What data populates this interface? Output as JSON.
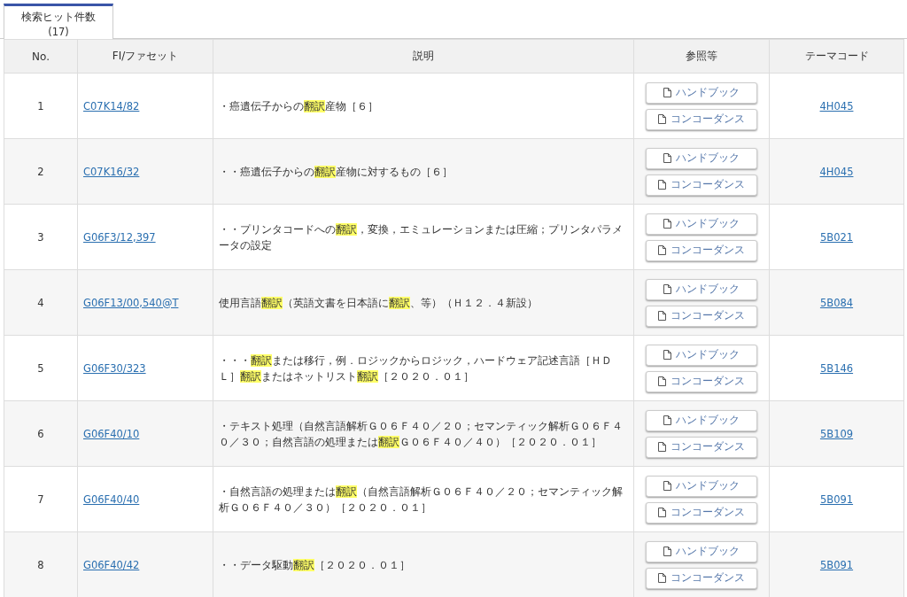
{
  "tab": {
    "label": "検索ヒット件数",
    "count": "(17)",
    "selected": true
  },
  "table": {
    "columns": [
      "No.",
      "FI/ファセット",
      "説明",
      "参照等",
      "テーマコード"
    ],
    "rows": [
      {
        "no": "1",
        "fi": "C07K14/82",
        "description": [
          {
            "text": "・癌遺伝子からの",
            "highlighted": false
          },
          {
            "text": "翻訳",
            "highlighted": true
          },
          {
            "text": "産物［６］",
            "highlighted": false
          }
        ],
        "buttons": [
          "ハンドブック",
          "コンコーダンス"
        ],
        "theme": "4H045"
      },
      {
        "no": "2",
        "fi": "C07K16/32",
        "description": [
          {
            "text": "・・癌遺伝子からの",
            "highlighted": false
          },
          {
            "text": "翻訳",
            "highlighted": true
          },
          {
            "text": "産物に対するもの［６］",
            "highlighted": false
          }
        ],
        "buttons": [
          "ハンドブック",
          "コンコーダンス"
        ],
        "theme": "4H045"
      },
      {
        "no": "3",
        "fi": "G06F3/12,397",
        "description": [
          {
            "text": "・・プリンタコードへの",
            "highlighted": false
          },
          {
            "text": "翻訳",
            "highlighted": true
          },
          {
            "text": "，変換，エミュレーションまたは圧縮；プリンタパラメータの設定",
            "highlighted": false
          }
        ],
        "buttons": [
          "ハンドブック",
          "コンコーダンス"
        ],
        "theme": "5B021"
      },
      {
        "no": "4",
        "fi": "G06F13/00,540@T",
        "description": [
          {
            "text": "使用言語",
            "highlighted": false
          },
          {
            "text": "翻訳",
            "highlighted": true
          },
          {
            "text": "（英語文書を日本語に",
            "highlighted": false
          },
          {
            "text": "翻訳",
            "highlighted": true
          },
          {
            "text": "、等）（Ｈ１２．４新設）",
            "highlighted": false
          }
        ],
        "buttons": [
          "ハンドブック",
          "コンコーダンス"
        ],
        "theme": "5B084"
      },
      {
        "no": "5",
        "fi": "G06F30/323",
        "description": [
          {
            "text": "・・・",
            "highlighted": false
          },
          {
            "text": "翻訳",
            "highlighted": true
          },
          {
            "text": "または移行，例．ロジックからロジック，ハードウェア記述言語［ＨＤＬ］",
            "highlighted": false
          },
          {
            "text": "翻訳",
            "highlighted": true
          },
          {
            "text": "またはネットリスト",
            "highlighted": false
          },
          {
            "text": "翻訳",
            "highlighted": true
          },
          {
            "text": "［２０２０．０１］",
            "highlighted": false
          }
        ],
        "buttons": [
          "ハンドブック",
          "コンコーダンス"
        ],
        "theme": "5B146"
      },
      {
        "no": "6",
        "fi": "G06F40/10",
        "description": [
          {
            "text": "・テキスト処理（自然言語解析Ｇ０６Ｆ４０／２０；セマンティック解析Ｇ０６Ｆ４０／３０；自然言語の処理または",
            "highlighted": false
          },
          {
            "text": "翻訳",
            "highlighted": true
          },
          {
            "text": "Ｇ０６Ｆ４０／４０）［２０２０．０１］",
            "highlighted": false
          }
        ],
        "buttons": [
          "ハンドブック",
          "コンコーダンス"
        ],
        "theme": "5B109"
      },
      {
        "no": "7",
        "fi": "G06F40/40",
        "description": [
          {
            "text": "・自然言語の処理または",
            "highlighted": false
          },
          {
            "text": "翻訳",
            "highlighted": true
          },
          {
            "text": "（自然言語解析Ｇ０６Ｆ４０／２０；セマンティック解析Ｇ０６Ｆ４０／３０）［２０２０．０１］",
            "highlighted": false
          }
        ],
        "buttons": [
          "ハンドブック",
          "コンコーダンス"
        ],
        "theme": "5B091"
      },
      {
        "no": "8",
        "fi": "G06F40/42",
        "description": [
          {
            "text": "・・データ駆動",
            "highlighted": false
          },
          {
            "text": "翻訳",
            "highlighted": true
          },
          {
            "text": "［２０２０．０１］",
            "highlighted": false
          }
        ],
        "buttons": [
          "ハンドブック",
          "コンコーダンス"
        ],
        "theme": "5B091"
      }
    ]
  }
}
